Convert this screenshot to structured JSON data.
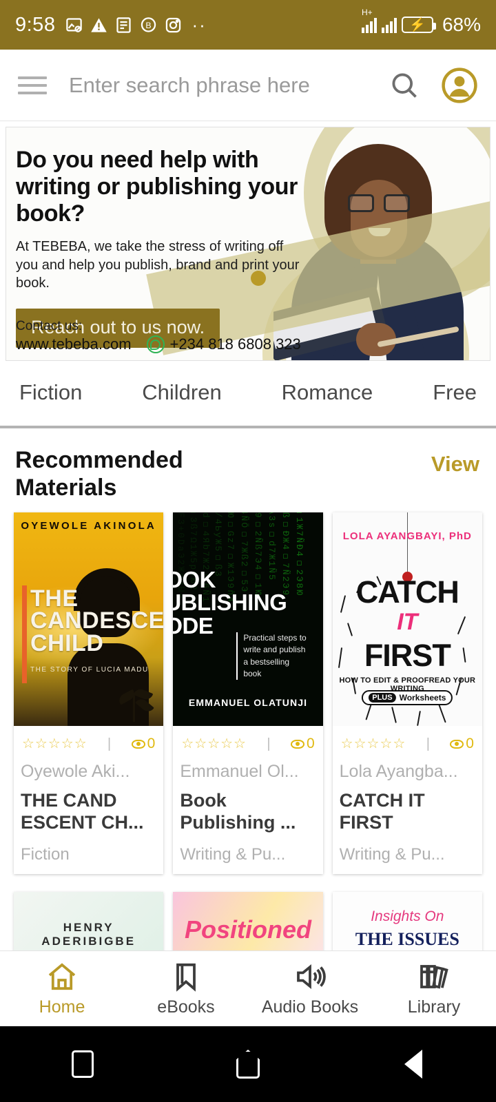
{
  "status_bar": {
    "time": "9:58",
    "icons": [
      "image-blocked-icon",
      "warning-icon",
      "news-icon",
      "messenger-b-icon",
      "instagram-icon"
    ],
    "overflow_dots": "··",
    "network_type": "H+",
    "battery_percent": "68%"
  },
  "header": {
    "menu_icon": "hamburger-icon",
    "search_placeholder": "Enter search phrase here",
    "search_value": "",
    "search_icon": "search-icon",
    "account_icon": "account-circle-icon"
  },
  "banner": {
    "title": "Do you need help with writing or publishing your book?",
    "subtitle": "At TEBEBA, we take the stress of writing off you and help you publish, brand and print your book.",
    "cta_label": "Reach out to us now.",
    "contact_label": "Contact us:",
    "website": "www.tebeba.com",
    "phone": "+234 818 6808 323",
    "whatsapp_icon": "whatsapp-icon"
  },
  "categories": [
    {
      "label": "Fiction"
    },
    {
      "label": "Children"
    },
    {
      "label": "Romance"
    },
    {
      "label": "Free"
    }
  ],
  "section": {
    "title": "Recommended Materials",
    "view_label": "View"
  },
  "books": [
    {
      "stars": "☆☆☆☆☆",
      "divider": "|",
      "views": "0",
      "author": "Oyewole Aki...",
      "title": "THE CAND ESCENT CH...",
      "category": "Fiction",
      "cover": {
        "author_line": "OYEWOLE AKINOLA",
        "title_line_1": "THE",
        "title_line_2": "CANDESCENT",
        "title_line_3": "CHILD",
        "subtitle": "THE STORY OF LUCIA MADU"
      }
    },
    {
      "stars": "☆☆☆☆☆",
      "divider": "|",
      "views": "0",
      "author": "Emmanuel Ol...",
      "title": "Book Publishing ...",
      "category": "Writing & Pu...",
      "cover": {
        "title_line_1": "OOK",
        "title_line_2": "UBLISHING",
        "title_line_3": "ODE",
        "description": "Practical steps to write and publish a bestselling book",
        "author_line": "EMMANUEL OLATUNJI"
      }
    },
    {
      "stars": "☆☆☆☆☆",
      "divider": "|",
      "views": "0",
      "author": "Lola Ayangba...",
      "title": "CATCH IT FIRST",
      "category": "Writing & Pu...",
      "cover": {
        "author_line": "LOLA AYANGBAYI, PhD",
        "word_1": "CATCH",
        "word_2": "IT",
        "word_3": "FIRST",
        "subtitle": "HOW TO EDIT & PROOFREAD YOUR WRITING",
        "badge_plus": "PLUS",
        "badge_text": "Worksheets"
      }
    }
  ],
  "books_row2": [
    {
      "cover_text": "HENRY ADERIBIGBE"
    },
    {
      "cover_text": "Positioned"
    },
    {
      "cover_text_1": "Insights On",
      "cover_text_2": "THE ISSUES"
    }
  ],
  "bottom_nav": [
    {
      "label": "Home",
      "icon": "home-icon",
      "active": true
    },
    {
      "label": "eBooks",
      "icon": "bookmark-icon",
      "active": false
    },
    {
      "label": "Audio Books",
      "icon": "speaker-icon",
      "active": false
    },
    {
      "label": "Library",
      "icon": "library-books-icon",
      "active": false
    }
  ],
  "android_nav": [
    {
      "icon": "recents-square-icon"
    },
    {
      "icon": "home-pentagon-icon"
    },
    {
      "icon": "back-triangle-icon"
    }
  ],
  "colors": {
    "status_bar_bg": "#8a7220",
    "accent_gold": "#b99a28",
    "cta_gold": "#8a7220",
    "text_dark": "#1d1d1d",
    "text_muted": "#b0b0b0"
  }
}
